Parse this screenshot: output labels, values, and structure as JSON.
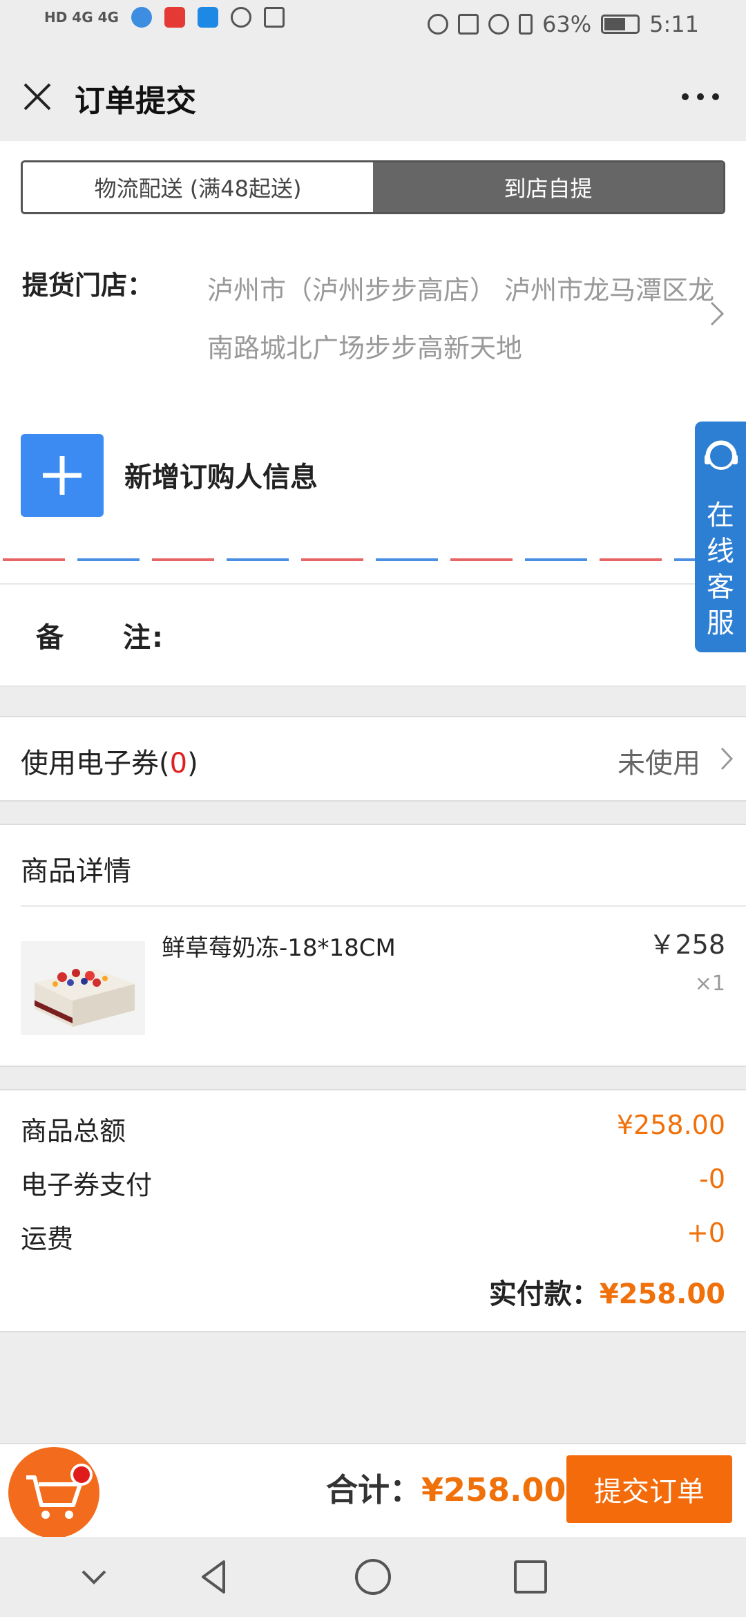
{
  "status_bar": {
    "left_indicators": "HD 4G 4G",
    "battery": "63%",
    "time": "5:11"
  },
  "header": {
    "title": "订单提交"
  },
  "delivery_tabs": {
    "logistics": "物流配送 (满48起送)",
    "pickup": "到店自提",
    "active": "pickup"
  },
  "store": {
    "label": "提货门店：",
    "address": "泸州市（泸州步步高店） 泸州市龙马潭区龙南路城北广场步步高新天地"
  },
  "orderer": {
    "add_label": "新增订购人信息"
  },
  "remark": {
    "label": "备　　注:"
  },
  "coupon": {
    "label": "使用电子券(",
    "count": "0",
    "suffix": ")",
    "status": "未使用"
  },
  "goods": {
    "header": "商品详情",
    "items": [
      {
        "name": "鲜草莓奶冻-18*18CM",
        "price": "￥258",
        "qty": "×1"
      }
    ]
  },
  "summary": {
    "subtotal_label": "商品总额",
    "subtotal_value": "¥258.00",
    "coupon_label": "电子券支付",
    "coupon_value": "-0",
    "shipping_label": "运费",
    "shipping_value": "+0",
    "paid_label": "实付款：",
    "paid_value": "¥258.00"
  },
  "service": {
    "label": "在线客服"
  },
  "footer": {
    "total_label": "合计：",
    "total_value": "¥258.00",
    "submit_label": "提交订单"
  },
  "colors": {
    "accent": "#f36b0a",
    "blue": "#3b8bf3",
    "service": "#2d7fd3"
  }
}
